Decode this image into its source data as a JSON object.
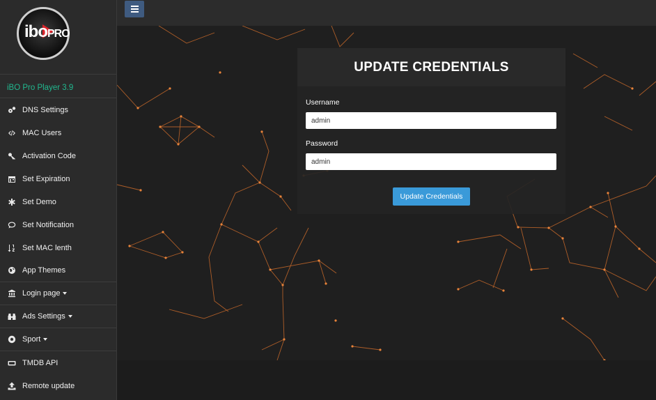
{
  "sidebar": {
    "logo": {
      "text_main": "ibo",
      "text_sub": "PRO"
    },
    "version": "iBO Pro Player 3.9",
    "items": [
      {
        "label": "DNS Settings",
        "icon": "cogs-icon"
      },
      {
        "label": "MAC Users",
        "icon": "code-icon"
      },
      {
        "label": "Activation Code",
        "icon": "key-icon"
      },
      {
        "label": "Set Expiration",
        "icon": "calendar-icon"
      },
      {
        "label": "Set Demo",
        "icon": "asterisk-icon"
      },
      {
        "label": "Set Notification",
        "icon": "comment-icon"
      },
      {
        "label": "Set MAC lenth",
        "icon": "sort-numeric-icon"
      },
      {
        "label": "App Themes",
        "icon": "globe-icon"
      },
      {
        "label": "Login page",
        "icon": "bank-icon"
      },
      {
        "label": "Ads Settings",
        "icon": "binoculars-icon"
      },
      {
        "label": "Sport",
        "icon": "soccer-ball-icon"
      },
      {
        "label": "TMDB API",
        "icon": "tv-icon"
      },
      {
        "label": "Remote update",
        "icon": "upload-icon"
      }
    ]
  },
  "form": {
    "title": "UPDATE CREDENTIALS",
    "username_label": "Username",
    "username_value": "admin",
    "password_label": "Password",
    "password_value": "admin",
    "submit_label": "Update Credentials"
  },
  "colors": {
    "accent_green": "#21b88f",
    "button_blue": "#3a9ad9",
    "menu_button": "#3f5b80",
    "network_orange": "#e8833a"
  }
}
